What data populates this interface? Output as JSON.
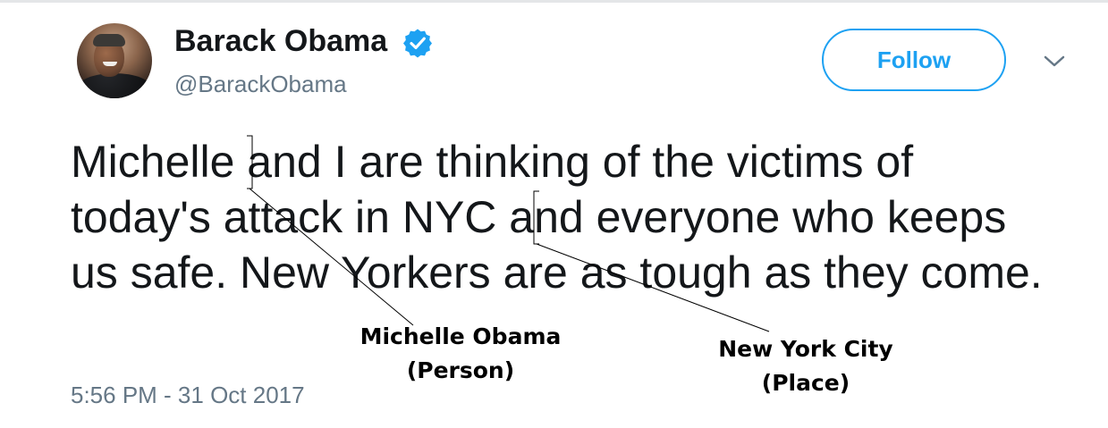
{
  "tweet": {
    "author": {
      "name": "Barack Obama",
      "handle": "@BarackObama",
      "verified": true,
      "avatar_description": "avatar-photo"
    },
    "follow_button": {
      "label": "Follow"
    },
    "menu_icon": "chevron-down-icon",
    "text": "Michelle and I are thinking of the victims of today's attack in NYC and everyone who keeps us safe. New Yorkers are as tough as they come.",
    "timestamp": "5:56 PM - 31 Oct 2017"
  },
  "annotations": [
    {
      "entity": "Michelle Obama",
      "type": "(Person)"
    },
    {
      "entity": "New York City",
      "type": "(Place)"
    }
  ],
  "colors": {
    "accent": "#1da1f2",
    "text_primary": "#14171a",
    "text_secondary": "#657786"
  }
}
